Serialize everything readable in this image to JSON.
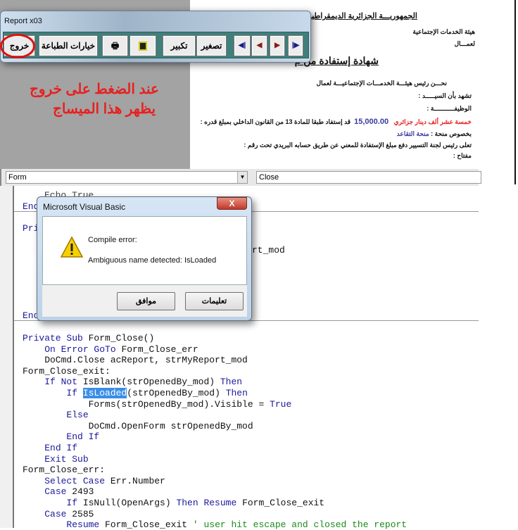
{
  "report_window": {
    "title": "Report x03",
    "buttons": {
      "exit": "خروج",
      "print_options": "خيارات الطباعة",
      "zoom_in": "تكبير",
      "zoom_out": "تصغير"
    },
    "icons": [
      "printer-icon",
      "save-icon",
      "first-page-icon",
      "previous-page-icon",
      "next-page-icon",
      "last-page-icon"
    ]
  },
  "annotation": {
    "line1": "عند الضغط على خروج",
    "line2": "يظهر هذا الميساج",
    "color": "#e82020"
  },
  "report": {
    "republic": "الجمهوريـــة الجزائرية الديمقراطية",
    "org": "هيئة الخدمات الإجتماعية",
    "org2": "لعمـــال",
    "heading": "شهادة إستفادة من م",
    "intro": "نحـــن رئيس هيئـــة الخدمـــات الإجتماعيـــة لعمال",
    "certify": "تشهد بأن السيـــــد :",
    "job": "الوظيفـــــــــــة :",
    "benefit": "قد إستفاد طبقا للمادة 13 من القانون الداخلي بمبلغ قدره :",
    "amount": "15,000.00",
    "amount_words": "خمسة عشر ألف دينار جزائري",
    "grant_label": "بخصوص منحة :",
    "grant_value": "منحة التقاعد",
    "instruction": "تعلى رئيس لجنة التسيير دفع مبلغ الإستفادة للمعني عن طريق حسابه البريدي تحت رقم :",
    "key": "مفتاح :"
  },
  "combos": {
    "object": "Form",
    "procedure": "Close"
  },
  "code_top": {
    "echo": "Echo True",
    "end1": "End Sub",
    "priv": "Private Sub",
    "frag": "rt_mod",
    "end2": "End Sub"
  },
  "code": [
    [
      [
        "Private Sub ",
        "kw"
      ],
      [
        "Form_Close()",
        ""
      ]
    ],
    [
      [
        "    ",
        ""
      ],
      [
        "On Error GoTo ",
        "kw"
      ],
      [
        "Form_Close_err",
        ""
      ]
    ],
    [
      [
        "    DoCmd.Close acReport, strMyReport_mod",
        ""
      ]
    ],
    [
      [
        "Form_Close_exit:",
        ""
      ]
    ],
    [
      [
        "    ",
        ""
      ],
      [
        "If Not ",
        "kw"
      ],
      [
        "IsBlank(strOpenedBy_mod) ",
        ""
      ],
      [
        "Then",
        "kw"
      ]
    ],
    [
      [
        "        ",
        ""
      ],
      [
        "If ",
        "kw"
      ],
      [
        "IsLoaded",
        "hl"
      ],
      [
        "(strOpenedBy_mod) ",
        ""
      ],
      [
        "Then",
        "kw"
      ]
    ],
    [
      [
        "            Forms(strOpenedBy_mod).Visible = ",
        ""
      ],
      [
        "True",
        "kw"
      ]
    ],
    [
      [
        "        ",
        ""
      ],
      [
        "Else",
        "kw"
      ]
    ],
    [
      [
        "            DoCmd.OpenForm strOpenedBy_mod",
        ""
      ]
    ],
    [
      [
        "        ",
        ""
      ],
      [
        "End If",
        "kw"
      ]
    ],
    [
      [
        "    ",
        ""
      ],
      [
        "End If",
        "kw"
      ]
    ],
    [
      [
        "    ",
        ""
      ],
      [
        "Exit Sub",
        "kw"
      ]
    ],
    [
      [
        "Form_Close_err:",
        ""
      ]
    ],
    [
      [
        "    ",
        ""
      ],
      [
        "Select Case ",
        "kw"
      ],
      [
        "Err.Number",
        ""
      ]
    ],
    [
      [
        "    ",
        ""
      ],
      [
        "Case ",
        "kw"
      ],
      [
        "2493",
        ""
      ]
    ],
    [
      [
        "        ",
        ""
      ],
      [
        "If ",
        "kw"
      ],
      [
        "IsNull(OpenArgs) ",
        ""
      ],
      [
        "Then Resume ",
        "kw"
      ],
      [
        "Form_Close_exit",
        ""
      ]
    ],
    [
      [
        "    ",
        ""
      ],
      [
        "Case ",
        "kw"
      ],
      [
        "2585",
        ""
      ]
    ],
    [
      [
        "        ",
        ""
      ],
      [
        "Resume ",
        "kw"
      ],
      [
        "Form_Close_exit ",
        ""
      ],
      [
        "' user hit escape and closed the report",
        "cm"
      ]
    ]
  ],
  "dialog": {
    "title": "Microsoft Visual Basic",
    "close": "X",
    "line1": "Compile error:",
    "line2": "Ambiguous name detected: IsLoaded",
    "ok": "موافق",
    "help": "تعليمات",
    "icon": "warning-icon"
  }
}
